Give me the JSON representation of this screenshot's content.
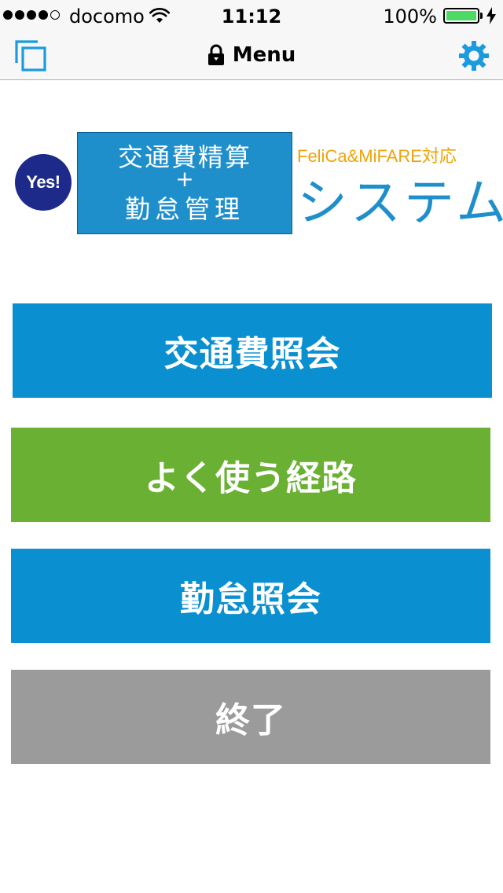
{
  "status_bar": {
    "carrier": "docomo",
    "time": "11:12",
    "battery_percent": "100%",
    "signal_bars_filled": 4,
    "signal_bars_total": 5
  },
  "nav": {
    "title": "Menu",
    "left_icon": "windows-icon",
    "right_icon": "gear-icon",
    "title_icon": "lock-icon"
  },
  "logo": {
    "badge": "Yes!",
    "line1": "交通費精算",
    "plus": "+",
    "line2": "勤怠管理",
    "tagline": "FeliCa&MiFARE対応",
    "system": "システム"
  },
  "menu": {
    "transport_inquiry": "交通費照会",
    "frequent_routes": "よく使う経路",
    "attendance_inquiry": "勤怠照会",
    "exit": "終了"
  },
  "colors": {
    "accent_blue": "#0a8fd0",
    "accent_green": "#6ab133",
    "neutral_gray": "#9b9b9b",
    "tagline_orange": "#f0a30a",
    "badge_navy": "#1d2a8a",
    "battery_green": "#4cd964"
  }
}
